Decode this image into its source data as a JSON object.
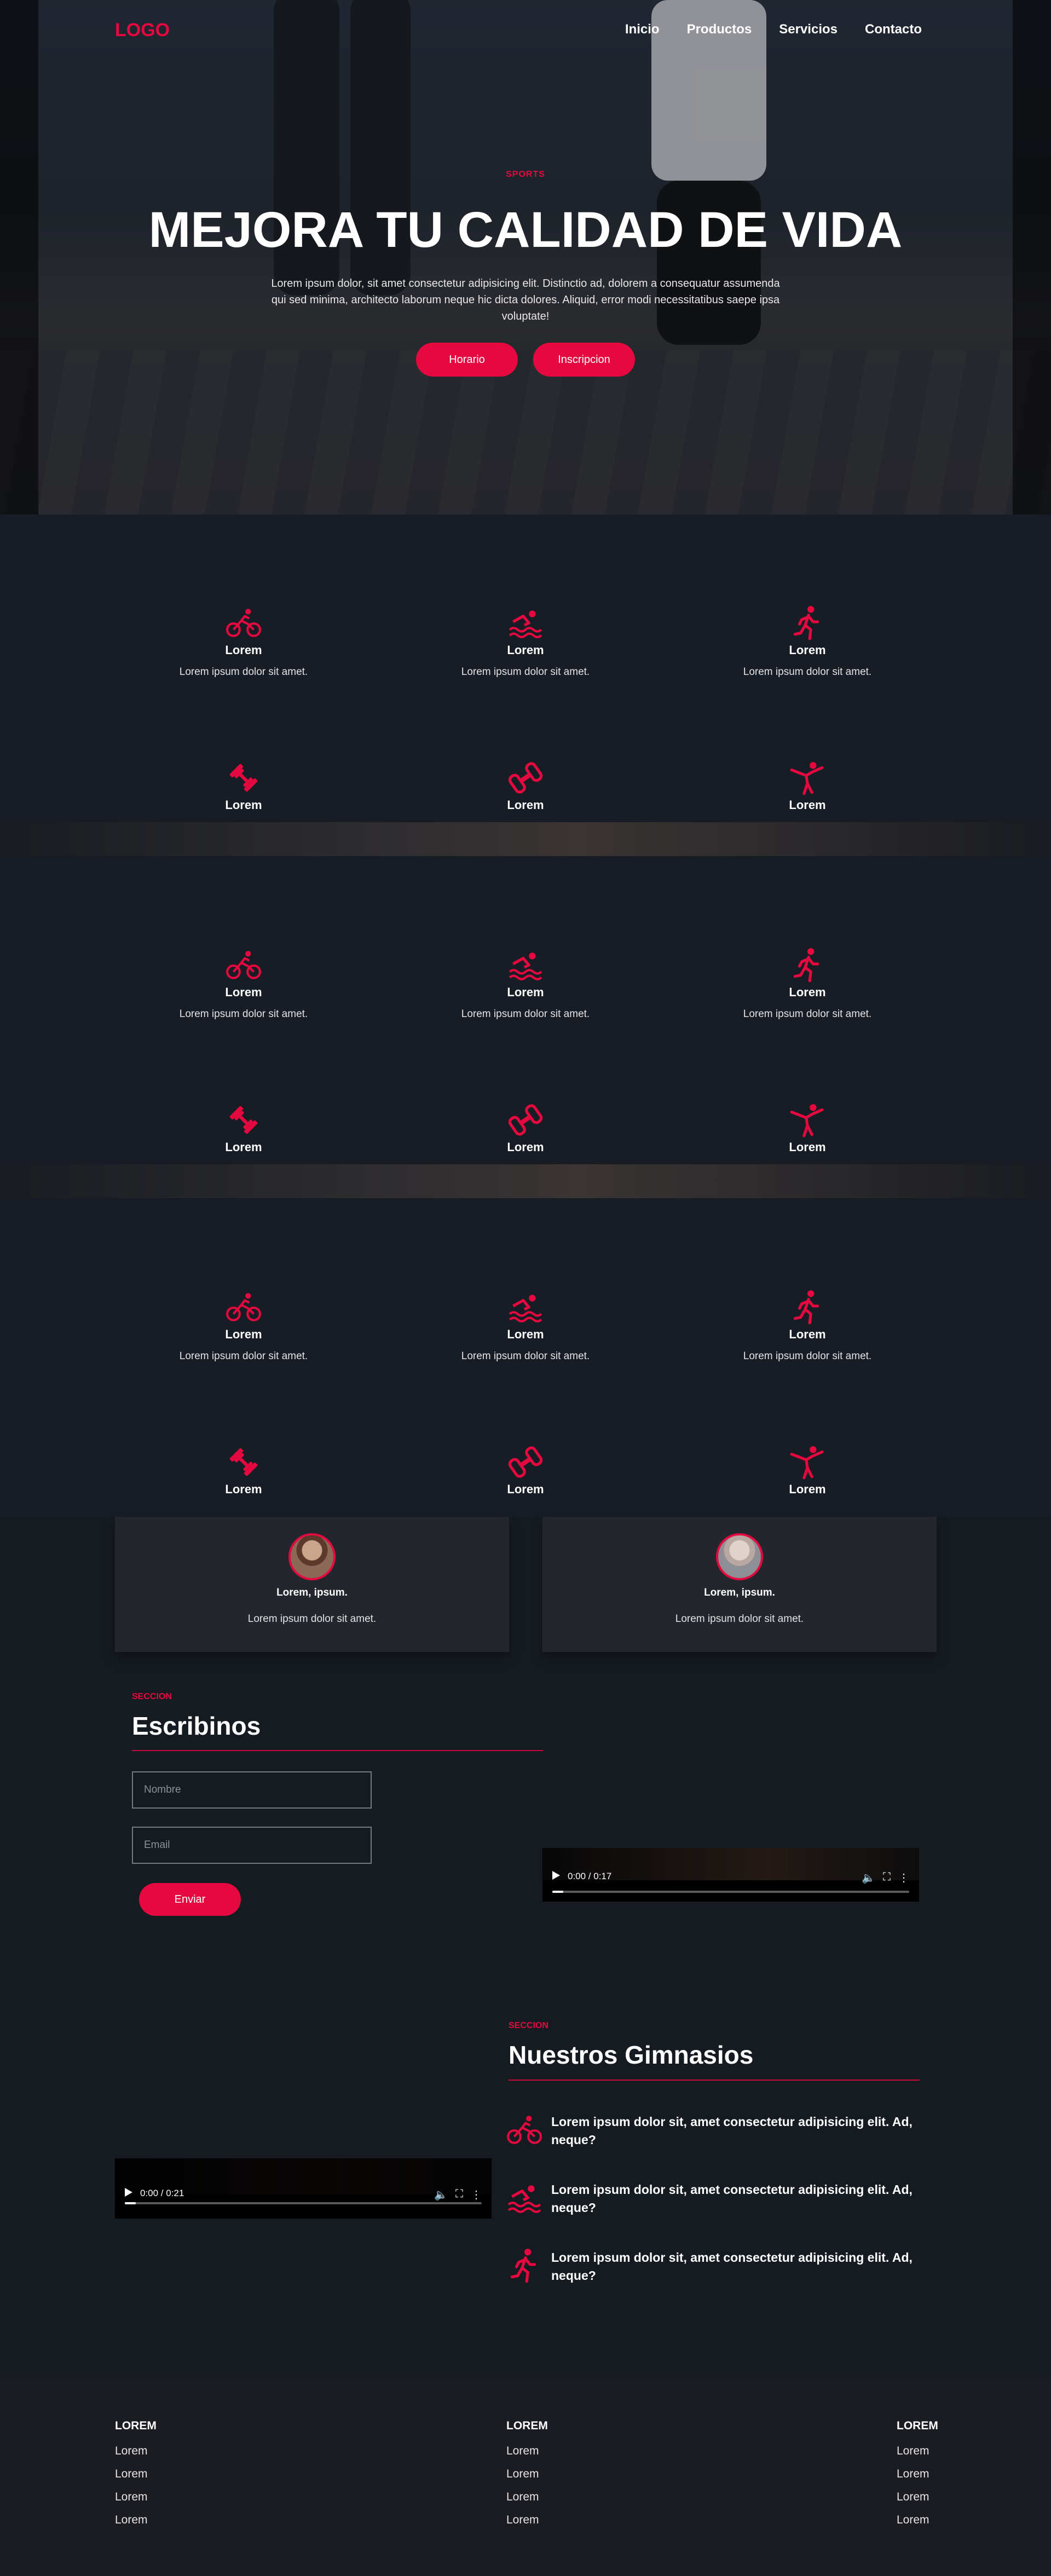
{
  "colors": {
    "accent": "#e5093f",
    "background": "#161b22",
    "card": "#24262d",
    "footer": "#1a1c21"
  },
  "nav": {
    "logo": "LOGO",
    "items": [
      "Inicio",
      "Productos",
      "Servicios",
      "Contacto"
    ]
  },
  "hero": {
    "eyebrow": "SPORTS",
    "title": "MEJORA TU CALIDAD DE VIDA",
    "text": "Lorem ipsum dolor, sit amet consectetur adipisicing elit. Distinctio ad, dolorem a consequatur assumenda qui sed minima, architecto laborum neque hic dicta dolores. Aliquid, error modi necessitatibus saepe ipsa voluptate!",
    "button_primary": "Horario",
    "button_secondary": "Inscripcion"
  },
  "features": {
    "row1": [
      {
        "icon": "cycling-icon",
        "title": "Lorem",
        "desc": "Lorem ipsum dolor sit amet."
      },
      {
        "icon": "swimming-icon",
        "title": "Lorem",
        "desc": "Lorem ipsum dolor sit amet."
      },
      {
        "icon": "running-icon",
        "title": "Lorem",
        "desc": "Lorem ipsum dolor sit amet."
      }
    ],
    "row2": [
      {
        "icon": "dumbbell-icon",
        "title": "Lorem"
      },
      {
        "icon": "weights-icon",
        "title": "Lorem"
      },
      {
        "icon": "martial-arts-icon",
        "title": "Lorem"
      }
    ]
  },
  "testimonials": [
    {
      "name": "Lorem, ipsum.",
      "text": "Lorem ipsum dolor sit amet."
    },
    {
      "name": "Lorem, ipsum.",
      "text": "Lorem ipsum dolor sit amet."
    }
  ],
  "contact": {
    "eyebrow": "SECCION",
    "title": "Escribinos",
    "name_placeholder": "Nombre",
    "email_placeholder": "Email",
    "submit": "Enviar"
  },
  "video1": {
    "time": "0:00 / 0:17",
    "progress": 0.03
  },
  "gyms": {
    "eyebrow": "SECCION",
    "title": "Nuestros Gimnasios",
    "items": [
      {
        "icon": "cycling-icon",
        "text": "Lorem ipsum dolor sit, amet consectetur adipisicing elit. Ad, neque?"
      },
      {
        "icon": "swimming-icon",
        "text": "Lorem ipsum dolor sit, amet consectetur adipisicing elit. Ad, neque?"
      },
      {
        "icon": "running-icon",
        "text": "Lorem ipsum dolor sit, amet consectetur adipisicing elit. Ad, neque?"
      }
    ]
  },
  "video2": {
    "time": "0:00 / 0:21",
    "progress": 0.03
  },
  "footer": {
    "columns": [
      {
        "heading": "LOREM",
        "links": [
          "Lorem",
          "Lorem",
          "Lorem",
          "Lorem"
        ]
      },
      {
        "heading": "LOREM",
        "links": [
          "Lorem",
          "Lorem",
          "Lorem",
          "Lorem"
        ]
      },
      {
        "heading": "LOREM",
        "links": [
          "Lorem",
          "Lorem",
          "Lorem",
          "Lorem"
        ]
      }
    ]
  }
}
